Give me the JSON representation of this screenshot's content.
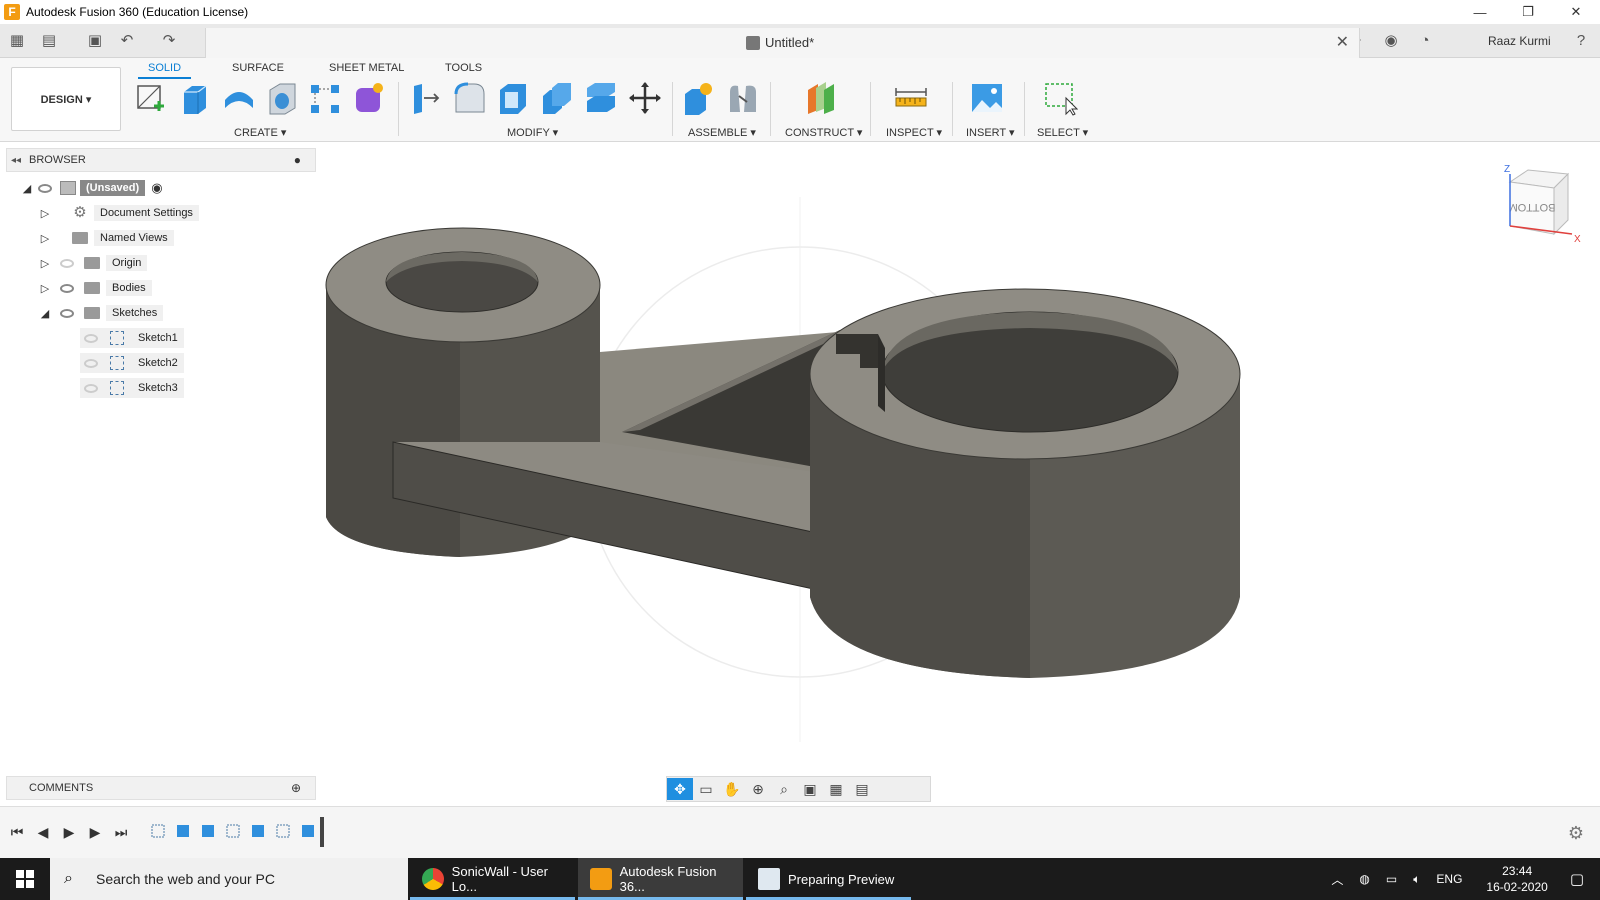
{
  "window": {
    "app_title": "Autodesk Fusion 360 (Education License)",
    "logo_letter": "F",
    "controls": {
      "minimize": "—",
      "restore": "❐",
      "close": "✕"
    }
  },
  "qab": {
    "doc_title": "Untitled*",
    "close": "✕",
    "user_name": "Raaz Kurmi"
  },
  "toolbar": {
    "workspace": "DESIGN ▾",
    "tabs": [
      "SOLID",
      "SURFACE",
      "SHEET METAL",
      "TOOLS"
    ],
    "active_tab": "SOLID",
    "groups": {
      "create": "CREATE ▾",
      "modify": "MODIFY ▾",
      "assemble": "ASSEMBLE ▾",
      "construct": "CONSTRUCT ▾",
      "inspect": "INSPECT ▾",
      "insert": "INSERT ▾",
      "select": "SELECT ▾"
    }
  },
  "browser": {
    "title": "BROWSER",
    "root": "(Unsaved)",
    "items": [
      {
        "label": "Document Settings"
      },
      {
        "label": "Named Views"
      },
      {
        "label": "Origin"
      },
      {
        "label": "Bodies"
      },
      {
        "label": "Sketches"
      }
    ],
    "sketches": [
      "Sketch1",
      "Sketch2",
      "Sketch3"
    ]
  },
  "viewcube": {
    "face": "BOTTOM",
    "axis_z": "Z",
    "axis_x": "X"
  },
  "comments": {
    "title": "COMMENTS"
  },
  "taskbar": {
    "search_placeholder": "Search the web and your PC",
    "apps": [
      {
        "label": "SonicWall - User Lo..."
      },
      {
        "label": "Autodesk Fusion 36..."
      },
      {
        "label": "Preparing Preview"
      }
    ],
    "language": "ENG",
    "time": "23:44",
    "date": "16-02-2020"
  },
  "colors": {
    "accent": "#0b7fd4",
    "model_body": "#5f5d56",
    "model_top": "#8d8a82",
    "taskbar": "#1b1b1b"
  }
}
